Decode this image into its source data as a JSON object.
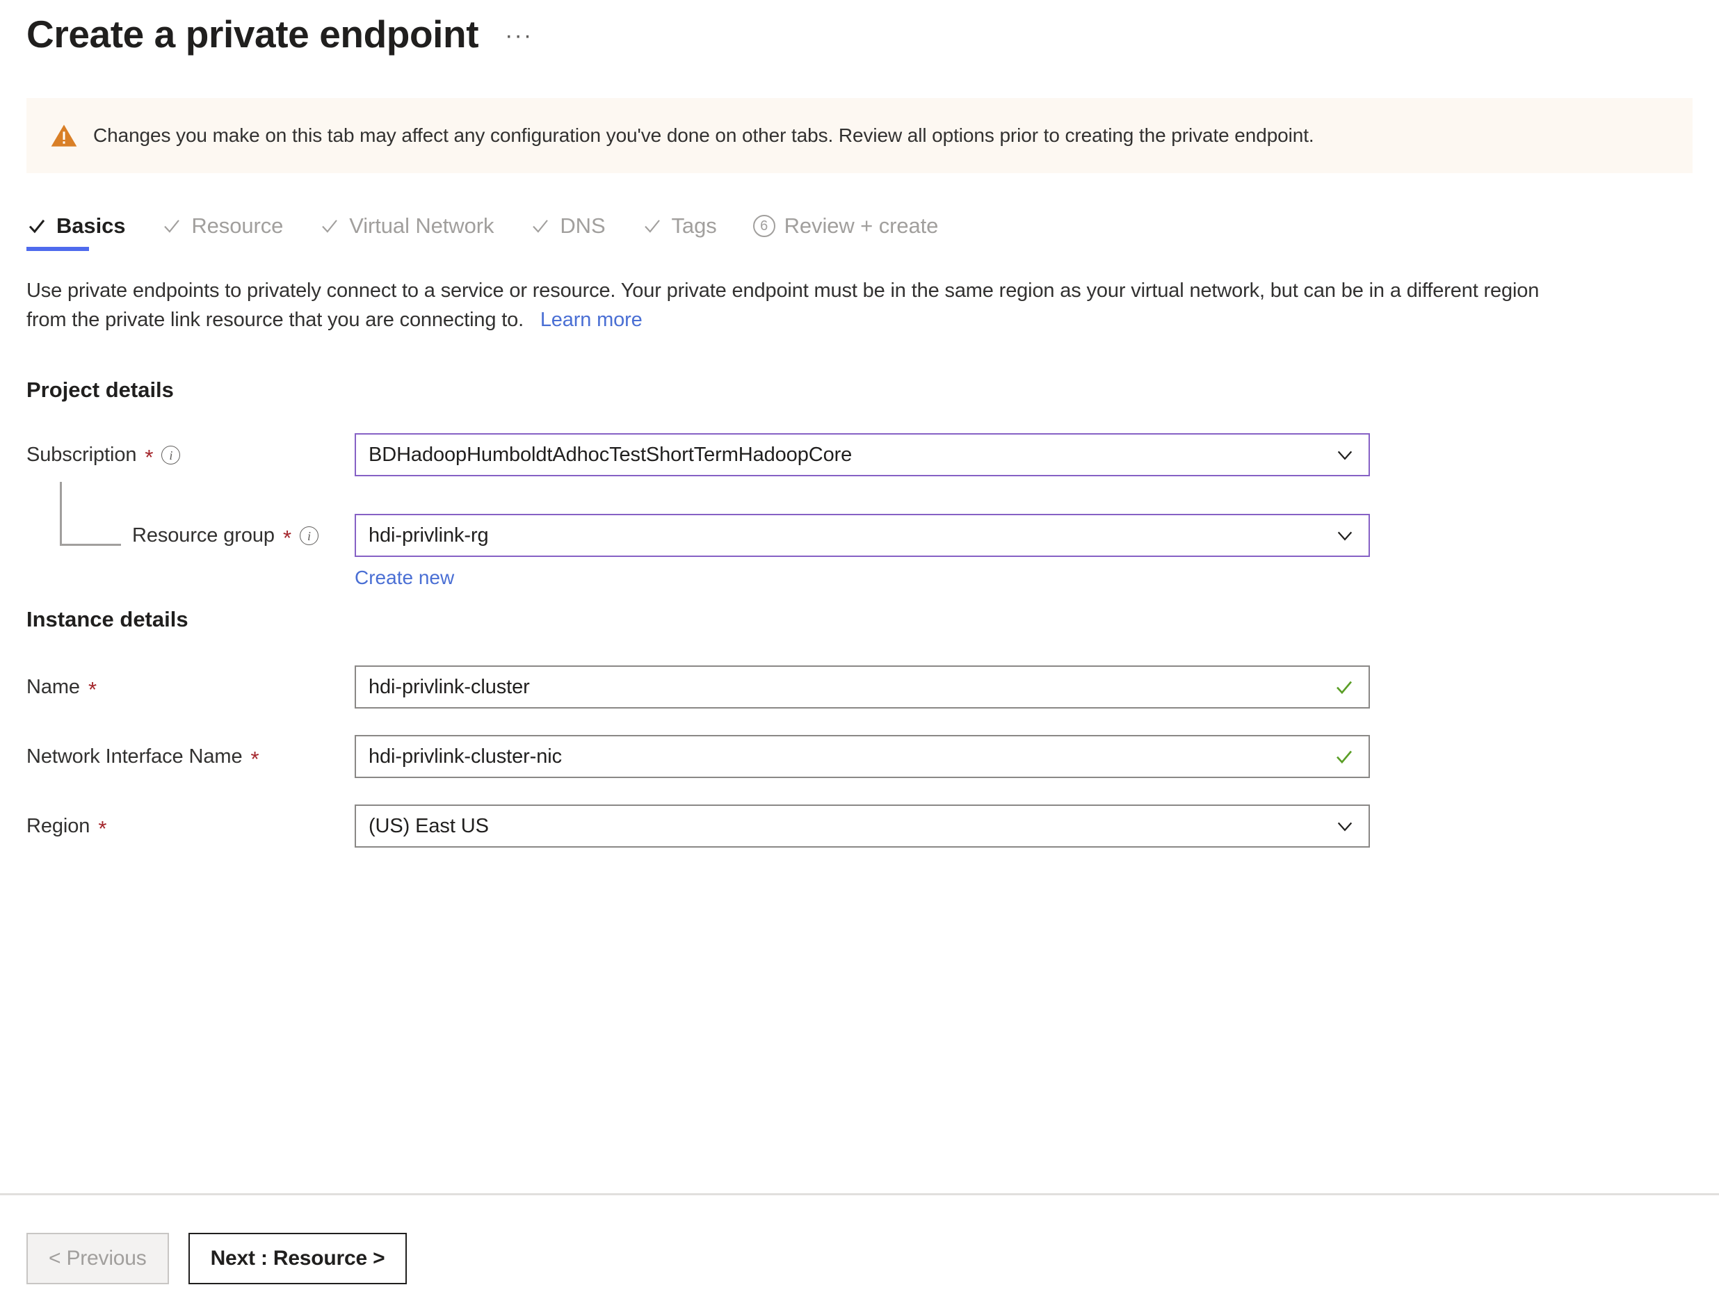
{
  "header": {
    "title": "Create a private endpoint",
    "more_menu": "···"
  },
  "banner": {
    "icon": "warning-triangle-icon",
    "text": "Changes you make on this tab may affect any configuration you've done on other tabs. Review all options prior to creating the private endpoint.",
    "background_color": "#fdf8f2",
    "icon_color": "#d97f27"
  },
  "tabs": [
    {
      "label": "Basics",
      "state": "completed",
      "active": true,
      "icon": "check-icon"
    },
    {
      "label": "Resource",
      "state": "completed",
      "active": false,
      "icon": "check-icon"
    },
    {
      "label": "Virtual Network",
      "state": "completed",
      "active": false,
      "icon": "check-icon"
    },
    {
      "label": "DNS",
      "state": "completed",
      "active": false,
      "icon": "check-icon"
    },
    {
      "label": "Tags",
      "state": "completed",
      "active": false,
      "icon": "check-icon"
    },
    {
      "label": "Review + create",
      "state": "pending",
      "active": false,
      "icon": "number-badge",
      "number": "6"
    }
  ],
  "description": {
    "text": "Use private endpoints to privately connect to a service or resource. Your private endpoint must be in the same region as your virtual network, but can be in a different region from the private link resource that you are connecting to.",
    "link_label": "Learn more"
  },
  "project_details": {
    "heading": "Project details",
    "subscription": {
      "label": "Subscription",
      "required": "*",
      "value": "BDHadoopHumboldtAdhocTestShortTermHadoopCore",
      "info": "i"
    },
    "resource_group": {
      "label": "Resource group",
      "required": "*",
      "value": "hdi-privlink-rg",
      "info": "i",
      "create_new_label": "Create new"
    }
  },
  "instance_details": {
    "heading": "Instance details",
    "name": {
      "label": "Name",
      "required": "*",
      "value": "hdi-privlink-cluster"
    },
    "network_interface_name": {
      "label": "Network Interface Name",
      "required": "*",
      "value": "hdi-privlink-cluster-nic"
    },
    "region": {
      "label": "Region",
      "required": "*",
      "value": "(US) East US"
    }
  },
  "footer": {
    "previous_label": "< Previous",
    "next_label": "Next : Resource >"
  },
  "colors": {
    "accent_blue": "#4f6bed",
    "link_blue": "#4a6fd4",
    "focus_purple": "#8661c5",
    "required_red": "#a4262c",
    "valid_green": "#5a9e26",
    "warning_orange": "#d97f27"
  }
}
